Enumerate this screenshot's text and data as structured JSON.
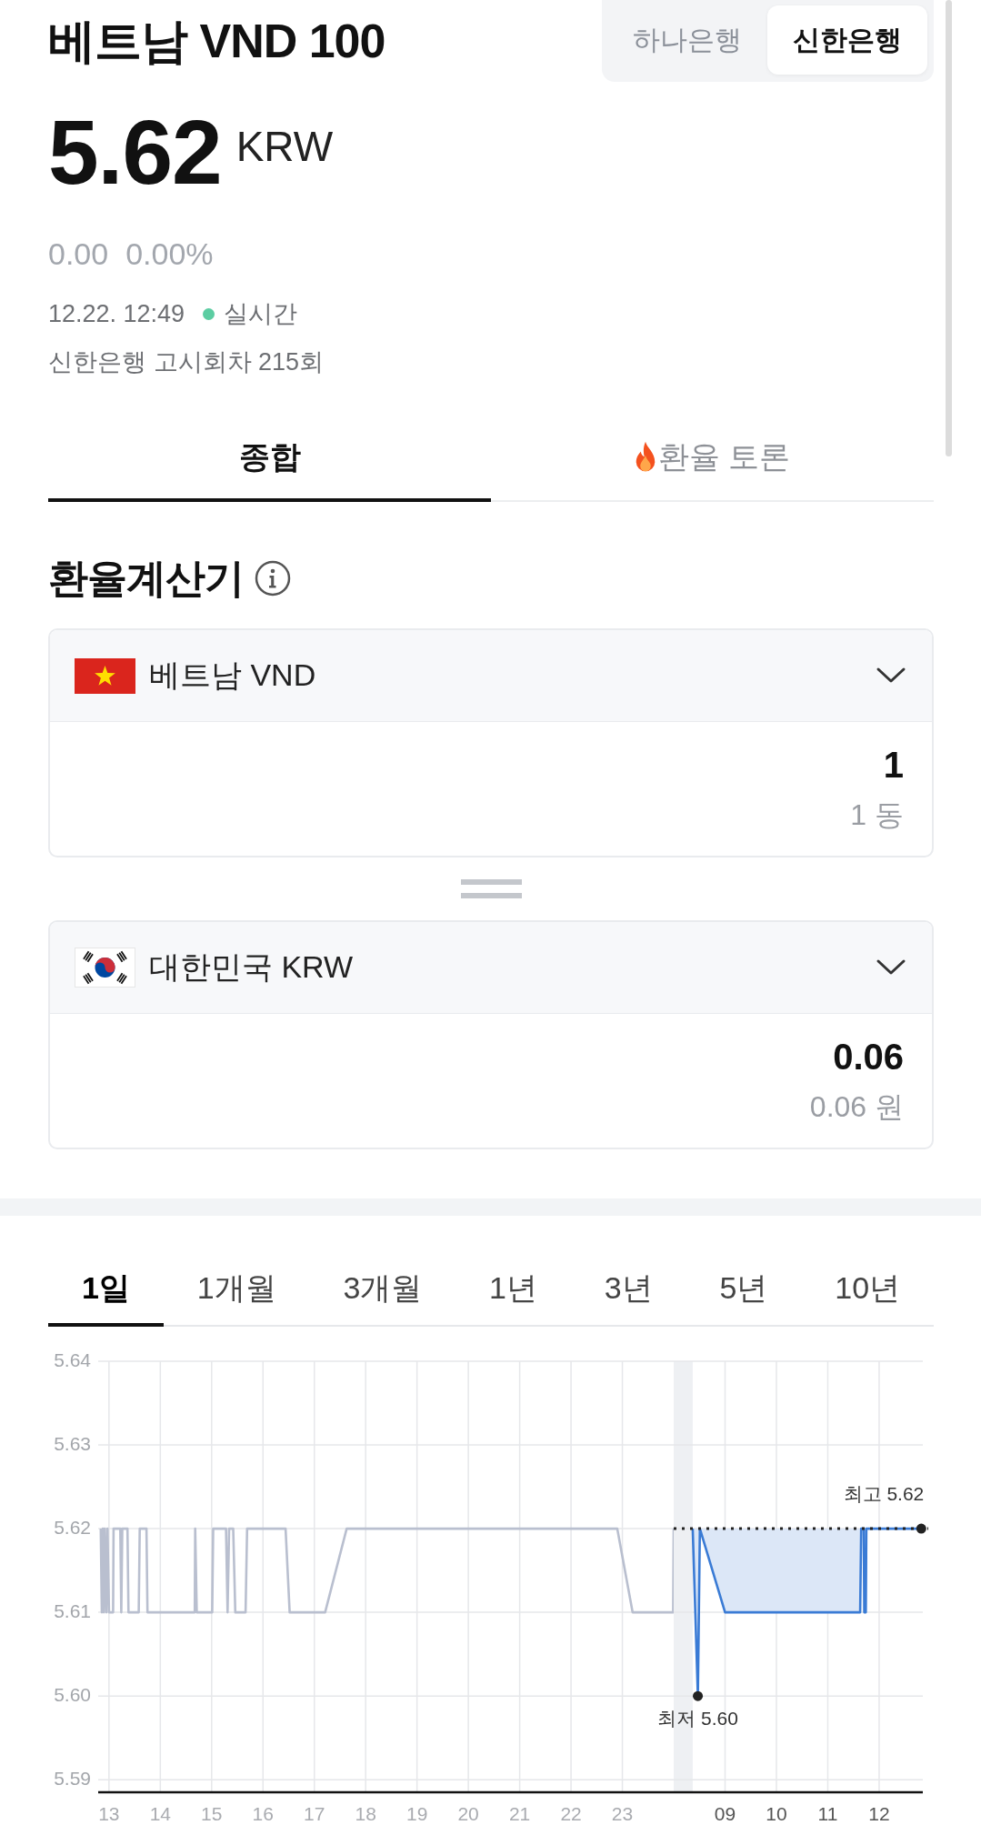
{
  "header": {
    "title": "베트남 VND 100",
    "banks": [
      {
        "label": "하나은행",
        "selected": false
      },
      {
        "label": "신한은행",
        "selected": true
      }
    ]
  },
  "quote": {
    "price": "5.62",
    "unit": "KRW",
    "change": "0.00",
    "change_rate": "0.00%",
    "time": "12.22. 12:49",
    "live": "실시간",
    "notice": "신한은행 고시회차 215회"
  },
  "tabs": [
    {
      "label": "종합",
      "selected": true,
      "hot": false
    },
    {
      "label": "환율 토론",
      "selected": false,
      "hot": true
    }
  ],
  "calculator": {
    "title": "환율계산기",
    "currencies": [
      {
        "kind": "vn",
        "name": "베트남 VND",
        "value": "1",
        "value_in_words": "1 동"
      },
      {
        "kind": "kr",
        "name": "대한민국 KRW",
        "value": "0.06",
        "value_in_words": "0.06 원"
      }
    ]
  },
  "chart": {
    "periods": [
      {
        "label": "1일",
        "selected": true
      },
      {
        "label": "1개월",
        "selected": false
      },
      {
        "label": "3개월",
        "selected": false
      },
      {
        "label": "1년",
        "selected": false
      },
      {
        "label": "3년",
        "selected": false
      },
      {
        "label": "5년",
        "selected": false
      },
      {
        "label": "10년",
        "selected": false
      }
    ],
    "plots": [
      {
        "chart_data": {
          "type": "line",
          "x": [
            12.84,
            12.86,
            12.88,
            12.9,
            12.92,
            12.95,
            12.97,
            13.0,
            13.08,
            13.09,
            13.22,
            13.24,
            13.26,
            13.36,
            13.38,
            13.58,
            13.6,
            13.73,
            13.75,
            14.67,
            14.68,
            14.71,
            15.01,
            15.03,
            15.28,
            15.31,
            15.34,
            15.42,
            15.46,
            15.66,
            15.69,
            16.44,
            16.52,
            17.21,
            17.63,
            22.9,
            23.2,
            23.99,
            24.0
          ],
          "series": [
            {
              "color": "#b9bfcf",
              "values": [
                5.62,
                5.61,
                5.62,
                5.61,
                5.62,
                5.61,
                5.62,
                5.61,
                5.61,
                5.62,
                5.62,
                5.61,
                5.62,
                5.62,
                5.61,
                5.61,
                5.62,
                5.62,
                5.61,
                5.61,
                5.62,
                5.61,
                5.61,
                5.62,
                5.62,
                5.61,
                5.62,
                5.62,
                5.61,
                5.61,
                5.62,
                5.62,
                5.61,
                5.61,
                5.62,
                5.62,
                5.61,
                5.61,
                5.62
              ]
            }
          ],
          "xlim": [
            12.79,
            24.0
          ],
          "ylim": [
            5.5885,
            5.64
          ],
          "xticks": [
            13,
            14,
            15,
            16,
            17,
            18,
            19,
            20,
            21,
            22,
            23
          ],
          "yticks": [
            {
              "value": 5.59,
              "label": "5.59"
            },
            {
              "value": 5.6,
              "label": "5.60"
            },
            {
              "value": 5.61,
              "label": "5.61"
            },
            {
              "value": 5.62,
              "label": "5.62"
            },
            {
              "value": 5.63,
              "label": "5.63"
            },
            {
              "value": 5.64,
              "label": "5.64"
            }
          ],
          "grid": true
        }
      },
      {
        "chart_data": {
          "type": "area",
          "x": [
            8.37,
            8.47,
            8.51,
            9.0,
            11.63,
            11.65,
            11.7,
            11.71,
            11.74,
            11.75,
            12.82
          ],
          "series": [
            {
              "color": "#3a7bd5",
              "values": [
                5.62,
                5.6,
                5.62,
                5.61,
                5.61,
                5.62,
                5.62,
                5.61,
                5.61,
                5.62,
                5.62
              ]
            }
          ],
          "xlim": [
            8.0,
            12.85
          ],
          "ylim": [
            5.5885,
            5.64
          ],
          "xticks": [
            {
              "value": 9,
              "label": "09"
            },
            10,
            11,
            12
          ],
          "grid": true,
          "bands": [
            {
              "axis": "x",
              "from": 8.0,
              "to": 8.37
            }
          ],
          "ref_lines": [
            {
              "axis": "y",
              "value": 5.62
            }
          ],
          "annotations": [
            {
              "text": "최저 5.60",
              "x": 8.47,
              "y": 5.6
            },
            {
              "text": "최고 5.62",
              "x": 12.82,
              "y": 5.62
            }
          ]
        }
      }
    ]
  }
}
